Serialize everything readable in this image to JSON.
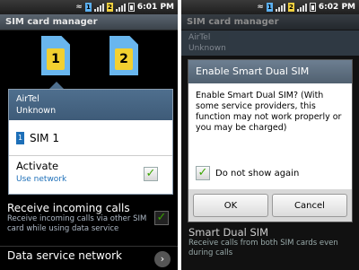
{
  "left_screen": {
    "status": {
      "time": "6:01 PM"
    },
    "title": "SIM card manager",
    "sim_cards": [
      "1",
      "2"
    ],
    "popup": {
      "carrier": "AirTel",
      "status": "Unknown",
      "sim_label": "SIM 1",
      "activate_label": "Activate",
      "activate_sub": "Use network"
    },
    "receive_calls": {
      "title": "Receive incoming calls",
      "subtitle": "Receive incoming calls via other SIM card while using data service"
    },
    "data_service": {
      "title": "Data service network"
    }
  },
  "right_screen": {
    "status": {
      "time": "6:02 PM"
    },
    "title": "SIM card manager",
    "ghost_carrier": "AirTel",
    "ghost_status": "Unknown",
    "dialog": {
      "title": "Enable Smart Dual SIM",
      "body": "Enable Smart Dual SIM? (With some service providers, this function may not work properly or you may be charged)",
      "checkbox_label": "Do not show again",
      "ok_label": "OK",
      "cancel_label": "Cancel"
    },
    "smart_dual": {
      "title": "Smart Dual SIM",
      "subtitle": "Receive calls from both SIM cards even during calls"
    }
  },
  "colors": {
    "accent": "#1d6fb8",
    "sim_blue": "#69b6ee",
    "sim_chip": "#f2d030",
    "check_green": "#3aa500"
  }
}
